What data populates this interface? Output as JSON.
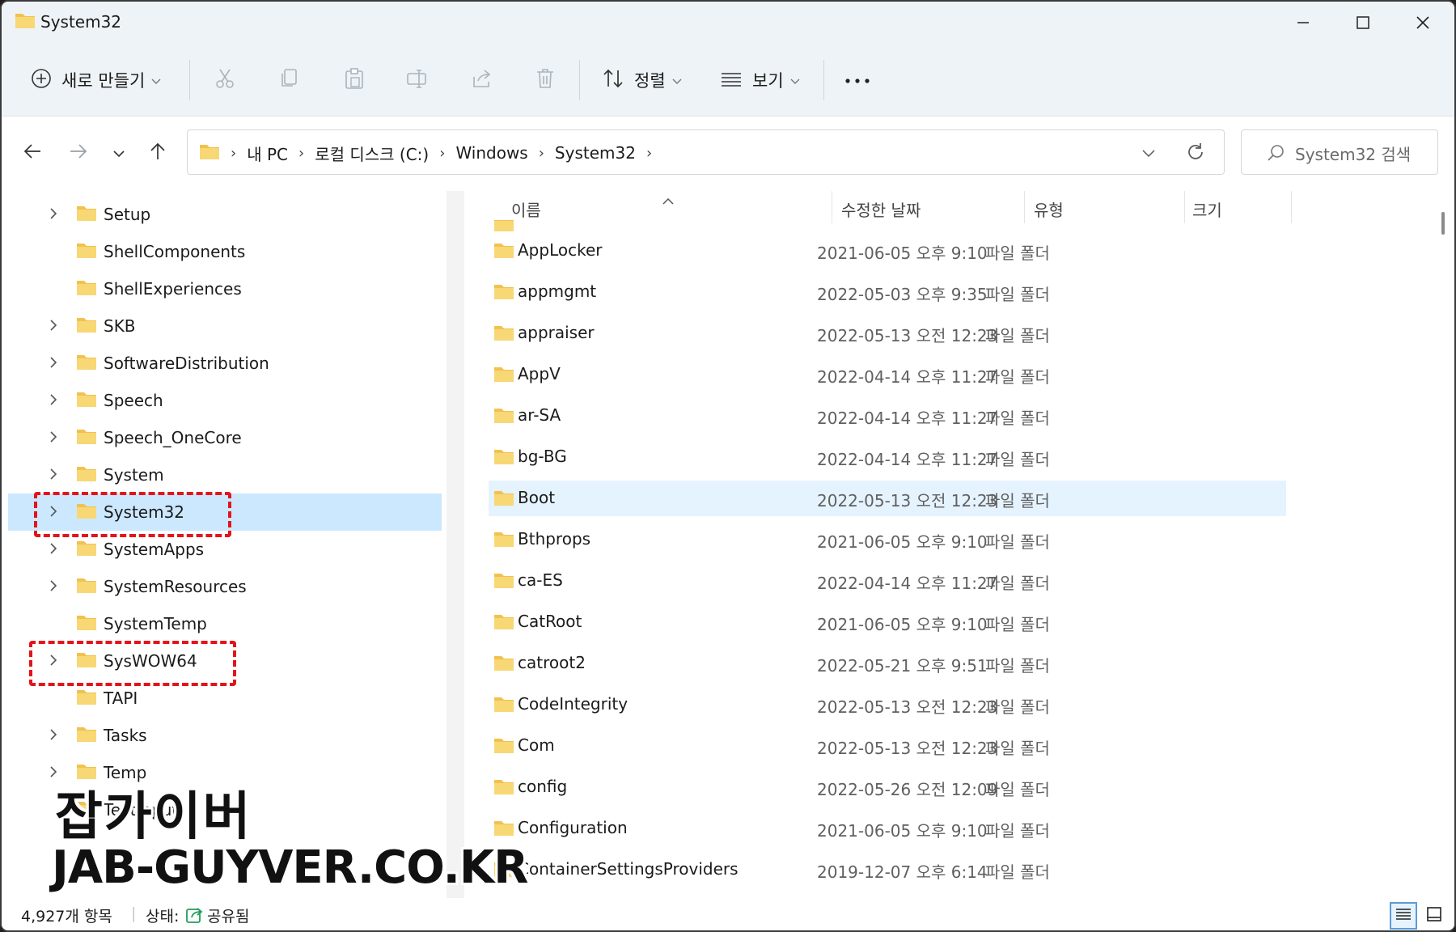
{
  "window": {
    "title": "System32",
    "folder_color": "#f2c14e",
    "accent": "#cce8ff"
  },
  "toolbar": {
    "new_label": "새로 만들기",
    "sort_label": "정렬",
    "view_label": "보기",
    "more_label": "..."
  },
  "address": {
    "crumbs": [
      "내 PC",
      "로컬 디스크 (C:)",
      "Windows",
      "System32"
    ],
    "search_placeholder": "System32 검색"
  },
  "tree": [
    {
      "label": "Setup",
      "expandable": true
    },
    {
      "label": "ShellComponents",
      "expandable": false
    },
    {
      "label": "ShellExperiences",
      "expandable": false
    },
    {
      "label": "SKB",
      "expandable": true
    },
    {
      "label": "SoftwareDistribution",
      "expandable": true
    },
    {
      "label": "Speech",
      "expandable": true
    },
    {
      "label": "Speech_OneCore",
      "expandable": true
    },
    {
      "label": "System",
      "expandable": true
    },
    {
      "label": "System32",
      "expandable": true,
      "selected": true
    },
    {
      "label": "SystemApps",
      "expandable": true
    },
    {
      "label": "SystemResources",
      "expandable": true
    },
    {
      "label": "SystemTemp",
      "expandable": false
    },
    {
      "label": "SysWOW64",
      "expandable": true
    },
    {
      "label": "TAPI",
      "expandable": false
    },
    {
      "label": "Tasks",
      "expandable": true
    },
    {
      "label": "Temp",
      "expandable": true
    },
    {
      "label": "TextInput",
      "expandable": false
    }
  ],
  "columns": {
    "name": "이름",
    "date": "수정한 날짜",
    "type": "유형",
    "size": "크기"
  },
  "files": [
    {
      "name": "AppLocker",
      "date": "2021-06-05 오후 9:10",
      "type": "파일 폴더"
    },
    {
      "name": "appmgmt",
      "date": "2022-05-03 오후 9:35",
      "type": "파일 폴더"
    },
    {
      "name": "appraiser",
      "date": "2022-05-13 오전 12:23",
      "type": "파일 폴더"
    },
    {
      "name": "AppV",
      "date": "2022-04-14 오후 11:27",
      "type": "파일 폴더"
    },
    {
      "name": "ar-SA",
      "date": "2022-04-14 오후 11:27",
      "type": "파일 폴더"
    },
    {
      "name": "bg-BG",
      "date": "2022-04-14 오후 11:27",
      "type": "파일 폴더"
    },
    {
      "name": "Boot",
      "date": "2022-05-13 오전 12:23",
      "type": "파일 폴더",
      "selected": true
    },
    {
      "name": "Bthprops",
      "date": "2021-06-05 오후 9:10",
      "type": "파일 폴더"
    },
    {
      "name": "ca-ES",
      "date": "2022-04-14 오후 11:27",
      "type": "파일 폴더"
    },
    {
      "name": "CatRoot",
      "date": "2021-06-05 오후 9:10",
      "type": "파일 폴더"
    },
    {
      "name": "catroot2",
      "date": "2022-05-21 오후 9:51",
      "type": "파일 폴더"
    },
    {
      "name": "CodeIntegrity",
      "date": "2022-05-13 오전 12:23",
      "type": "파일 폴더"
    },
    {
      "name": "Com",
      "date": "2022-05-13 오전 12:23",
      "type": "파일 폴더"
    },
    {
      "name": "config",
      "date": "2022-05-26 오전 12:09",
      "type": "파일 폴더"
    },
    {
      "name": "Configuration",
      "date": "2021-06-05 오후 9:10",
      "type": "파일 폴더"
    },
    {
      "name": "ContainerSettingsProviders",
      "date": "2019-12-07 오후 6:14",
      "type": "파일 폴더"
    }
  ],
  "status": {
    "count": "4,927개 항목",
    "state_label": "상태:",
    "state_value": "공유됨"
  },
  "watermark": {
    "line1": "잡가이버",
    "line2": "JAB-GUYVER.CO.KR"
  }
}
